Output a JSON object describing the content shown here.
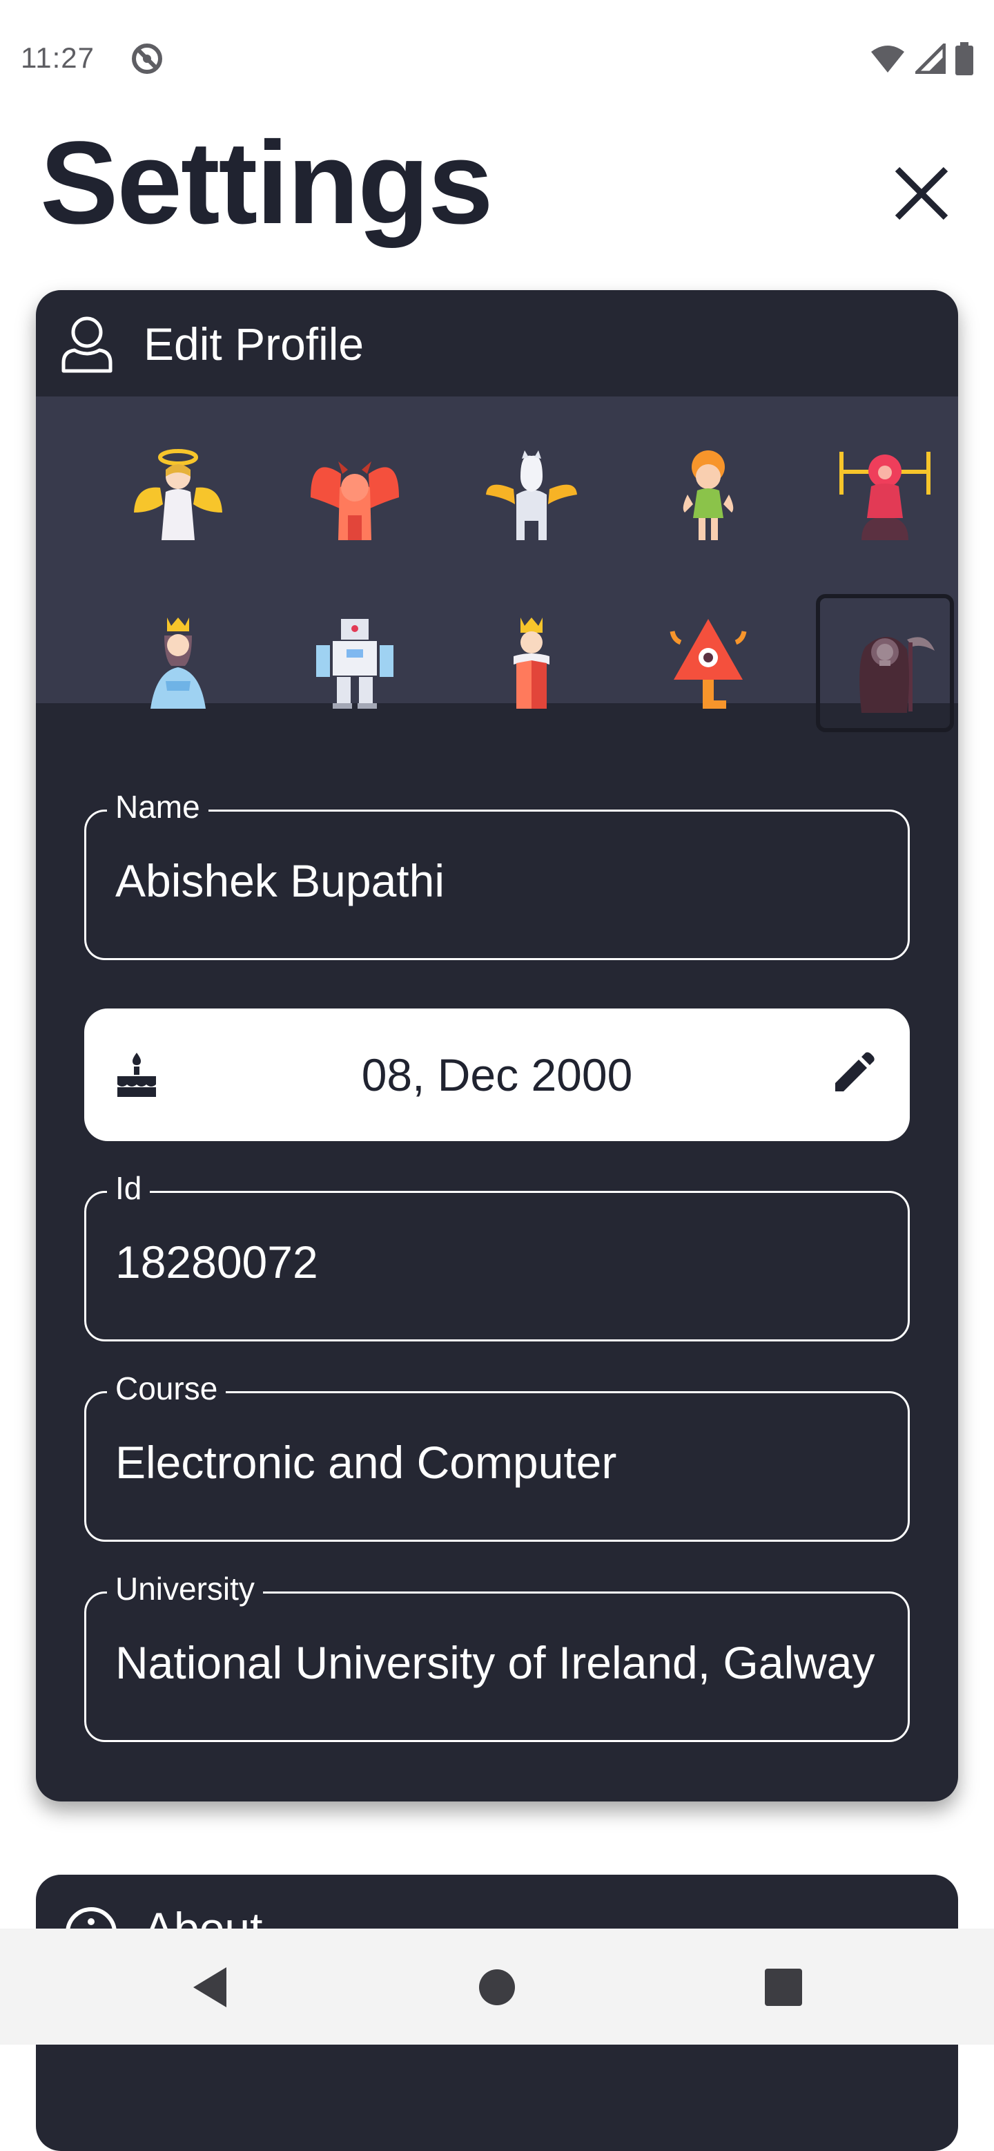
{
  "status_bar": {
    "time": "11:27"
  },
  "header": {
    "title": "Settings"
  },
  "profile_card": {
    "title": "Edit Profile",
    "avatars": [
      {
        "name": "angel"
      },
      {
        "name": "demon"
      },
      {
        "name": "pegasus"
      },
      {
        "name": "fairy"
      },
      {
        "name": "alien"
      },
      {
        "name": "queen"
      },
      {
        "name": "robot"
      },
      {
        "name": "king"
      },
      {
        "name": "monster"
      },
      {
        "name": "reaper",
        "selected": true
      }
    ],
    "fields": {
      "name": {
        "label": "Name",
        "value": "Abishek Bupathi"
      },
      "dob": {
        "value": "08, Dec 2000"
      },
      "id": {
        "label": "Id",
        "value": "18280072"
      },
      "course": {
        "label": "Course",
        "value": "Electronic and Computer"
      },
      "university": {
        "label": "University",
        "value": "National University of Ireland, Galway"
      }
    }
  },
  "about_card": {
    "title": "About"
  },
  "colors": {
    "card_bg": "#252733",
    "avatar_bg": "#383a4c",
    "title": "#202330"
  }
}
